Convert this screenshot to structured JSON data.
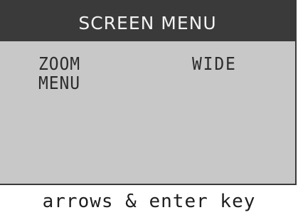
{
  "screen": {
    "title": "SCREEN MENU",
    "item": {
      "label": "ZOOM\nMENU",
      "value": "WIDE"
    },
    "hint": "arrows & enter key"
  },
  "colors": {
    "title_bg": "#3a3a3a",
    "title_text": "#f2f2f2",
    "panel_bg": "#c8c8c8",
    "text": "#2c2c2c"
  }
}
